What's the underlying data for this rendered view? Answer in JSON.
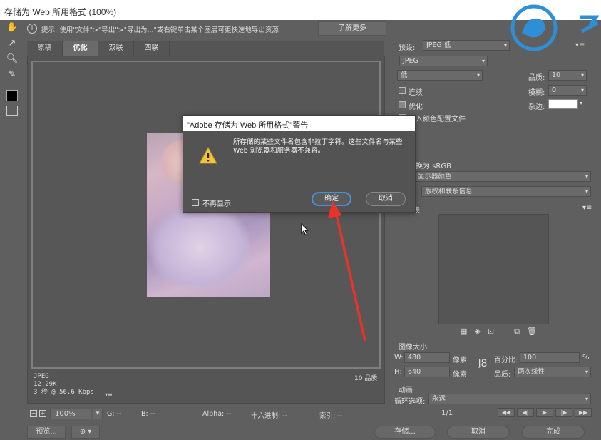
{
  "window": {
    "title": "存储为 Web 所用格式 (100%)"
  },
  "hint": {
    "text": "提示: 使用\"文件\">\"导出\">\"导出为...\"或右键单击某个图层可更快速地导出资源",
    "learn_more": "了解更多"
  },
  "tabs": [
    {
      "label": "原稿"
    },
    {
      "label": "优化"
    },
    {
      "label": "双联"
    },
    {
      "label": "四联"
    }
  ],
  "canvas_info": {
    "format": "JPEG",
    "size": "12.29K",
    "time": "3 秒 @ 56.6 Kbps",
    "quality": "10 品质"
  },
  "statusbar": {
    "zoom": "100%",
    "g": "G: --",
    "b": "B: --",
    "alpha": "Alpha: --",
    "hex": "十六进制: --",
    "index": "索引: --"
  },
  "bottom": {
    "preview": "预览...",
    "save": "存储...",
    "cancel": "取消",
    "done": "完成"
  },
  "right": {
    "preset_label": "预设:",
    "preset_value": "JPEG 低",
    "format": "JPEG",
    "compression": "低",
    "quality_label": "品质:",
    "quality_value": "10",
    "progressive": "连续",
    "blur_label": "模糊:",
    "blur_value": "0",
    "optimized": "优化",
    "matte_label": "杂边:",
    "embed_profile": "嵌入颜色配置文件",
    "convert_srgb": "转换为 sRGB",
    "preview_label": "显示器颜色",
    "metadata": "版权和联系信息",
    "color_table": "颜色表",
    "image_size": "图像大小",
    "w_label": "W:",
    "w_value": "480",
    "h_label": "H:",
    "h_value": "640",
    "px": "像素",
    "percent_label": "百分比:",
    "percent_value": "100",
    "percent_sign": "%",
    "quality2_label": "品质:",
    "quality2_value": "两次线性",
    "animation": "动画",
    "loop_label": "循环选项:",
    "loop_value": "永远",
    "frame": "1/1"
  },
  "dialog": {
    "title": "\"Adobe 存储为 Web 所用格式\"警告",
    "message": "所存储的某些文件名包含非拉丁字符。这些文件名与某些 Web 浏览器和服务器不兼容。",
    "dont_show": "不再显示",
    "ok": "确定",
    "cancel": "取消"
  },
  "colors": {
    "annotation_arrow": "#e8332a",
    "dialog_focus": "#4a90d9",
    "logo": "#2f8fd6"
  }
}
